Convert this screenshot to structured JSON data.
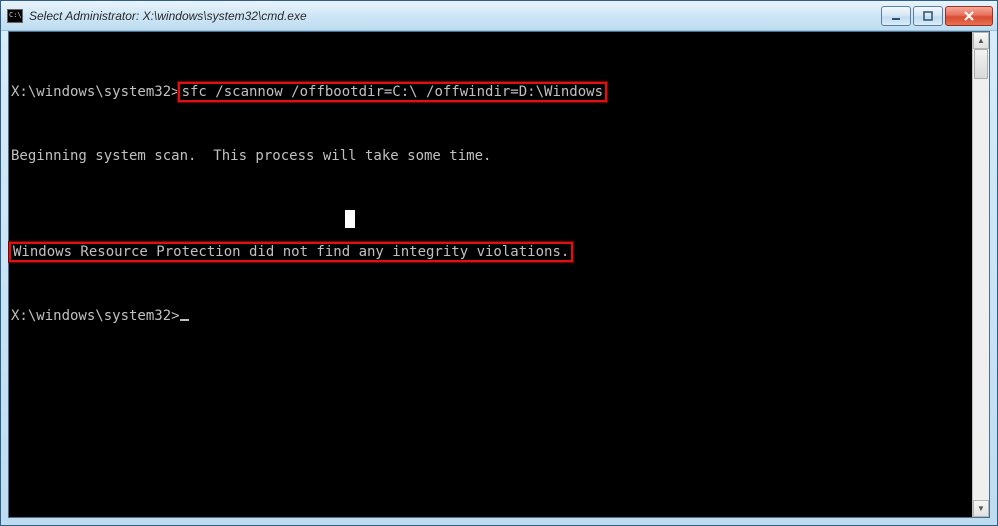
{
  "window": {
    "title": "Select Administrator: X:\\windows\\system32\\cmd.exe",
    "icon_glyph": "C:\\."
  },
  "terminal": {
    "prompt1": "X:\\windows\\system32>",
    "command": "sfc /scannow /offbootdir=C:\\ /offwindir=D:\\Windows",
    "msg_begin": "Beginning system scan.  This process will take some time.",
    "msg_result": "Windows Resource Protection did not find any integrity violations.",
    "prompt2": "X:\\windows\\system32>"
  },
  "scrollbar": {
    "up": "▲",
    "down": "▼"
  },
  "highlights": {
    "color": "#d11010"
  }
}
